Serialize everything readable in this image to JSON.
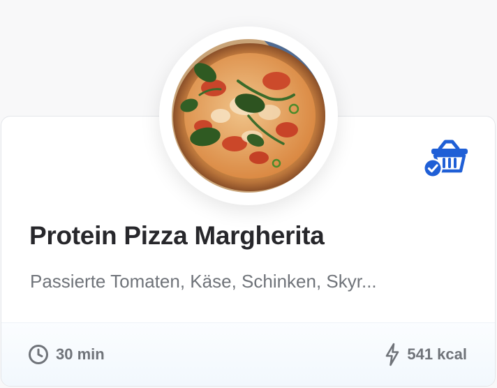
{
  "recipe": {
    "title": "Protein Pizza Margherita",
    "ingredients": "Passierte Tomaten, Käse, Schinken, Skyr...",
    "image_alt": "Pizza",
    "time": "30 min",
    "calories": "541 kcal",
    "basket_icon": "basket-check-icon",
    "time_icon": "clock-icon",
    "calories_icon": "bolt-icon"
  },
  "colors": {
    "accent": "#1f5fd6",
    "title": "#27272b",
    "muted": "#6f7379"
  }
}
